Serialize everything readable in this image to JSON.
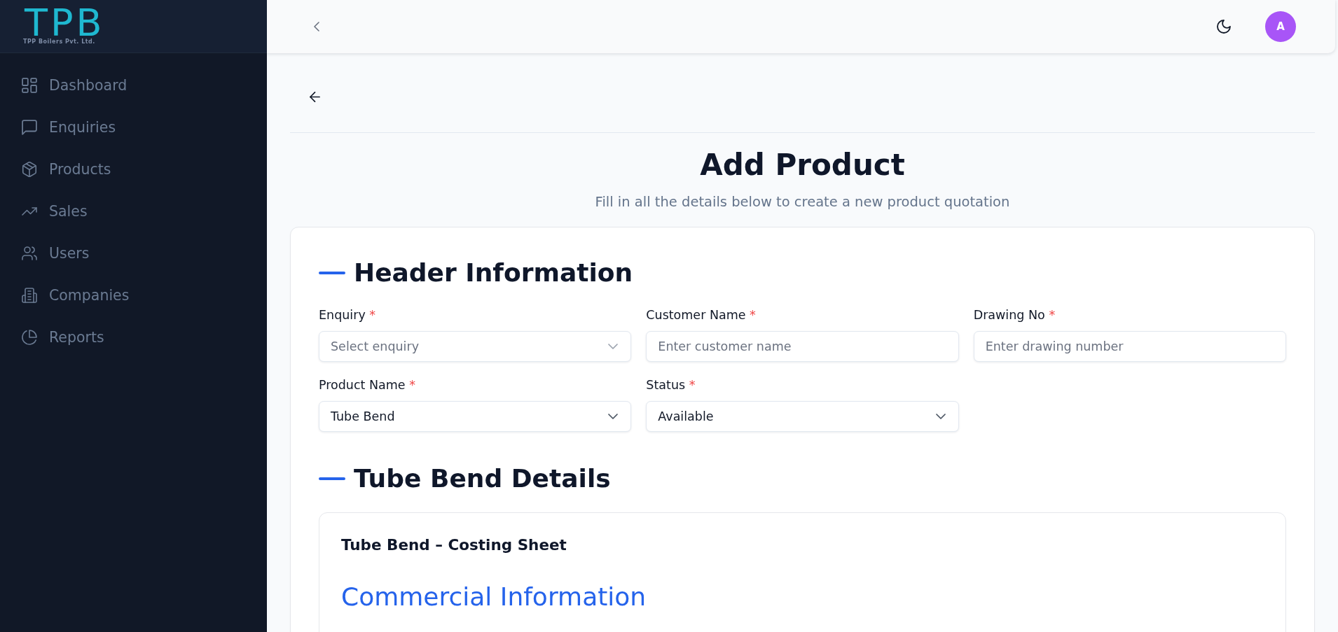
{
  "sidebar": {
    "logo": {
      "wordmark": "TPB",
      "tagline": "TPP Boilers Pvt. Ltd."
    },
    "items": [
      {
        "label": "Dashboard",
        "selected": false
      },
      {
        "label": "Enquiries",
        "selected": false
      },
      {
        "label": "Products",
        "selected": false
      },
      {
        "label": "Sales",
        "selected": false
      },
      {
        "label": "Users",
        "selected": false
      },
      {
        "label": "Companies",
        "selected": false
      },
      {
        "label": "Reports",
        "selected": false
      }
    ]
  },
  "topbar": {
    "avatar": {
      "initial": "A"
    }
  },
  "page": {
    "title": "Add Product",
    "subtitle": "Fill in all the details below to create a new product quotation"
  },
  "form": {
    "sections": [
      {
        "kind": "fields",
        "title": "Header Information",
        "fields": [
          {
            "kind": "select",
            "label": "Enquiry",
            "required_mark": "*",
            "placeholder": "Select enquiry"
          },
          {
            "kind": "text",
            "label": "Customer Name",
            "required_mark": "*",
            "placeholder": "Enter customer name"
          },
          {
            "kind": "text",
            "label": "Drawing No",
            "required_mark": "*",
            "placeholder": "Enter drawing number"
          },
          {
            "kind": "select",
            "label": "Product Name",
            "required_mark": "*",
            "value": "Tube Bend"
          },
          {
            "kind": "select",
            "label": "Status",
            "required_mark": "*",
            "value": "Available"
          }
        ]
      },
      {
        "kind": "sheet",
        "title": "Tube Bend Details",
        "sheet": {
          "title": "Tube Bend – Costing Sheet",
          "heading": "Commercial Information"
        }
      }
    ]
  }
}
